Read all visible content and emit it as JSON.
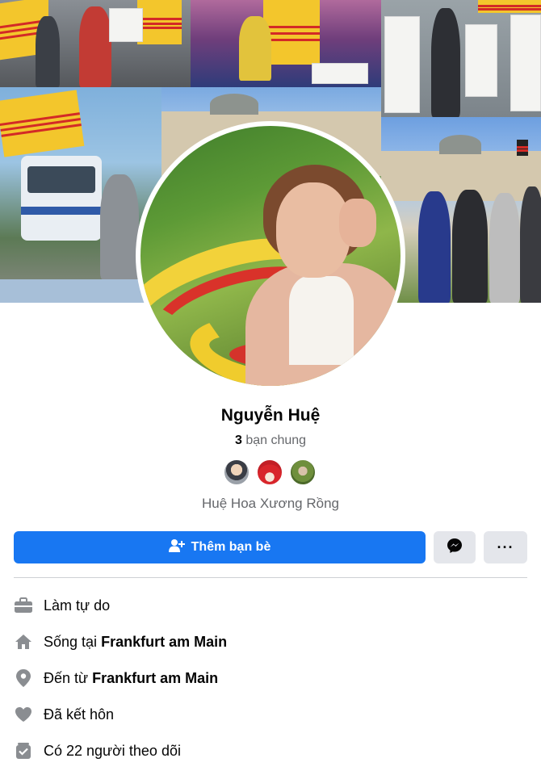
{
  "profile": {
    "name": "Nguyễn Huệ",
    "mutual_count": "3",
    "mutual_label": "bạn chung",
    "nickname": "Huệ Hoa Xương Rồng"
  },
  "actions": {
    "add_friend_label": "Thêm bạn bè"
  },
  "intro": {
    "work": "Làm tự do",
    "lives_prefix": "Sống tại",
    "lives_city": "Frankfurt am Main",
    "from_prefix": "Đến từ",
    "from_city": "Frankfurt am Main",
    "relationship": "Đã kết hôn",
    "followers": "Có 22 người theo dõi"
  },
  "icons": [
    "user-plus-icon",
    "messenger-icon",
    "more-icon",
    "briefcase-icon",
    "home-icon",
    "location-pin-icon",
    "heart-icon",
    "followers-icon"
  ],
  "colors": {
    "primary_button": "#1877f2",
    "secondary_button": "#e4e6eb",
    "muted_text": "#65676b",
    "icon_gray": "#8a8d91"
  }
}
